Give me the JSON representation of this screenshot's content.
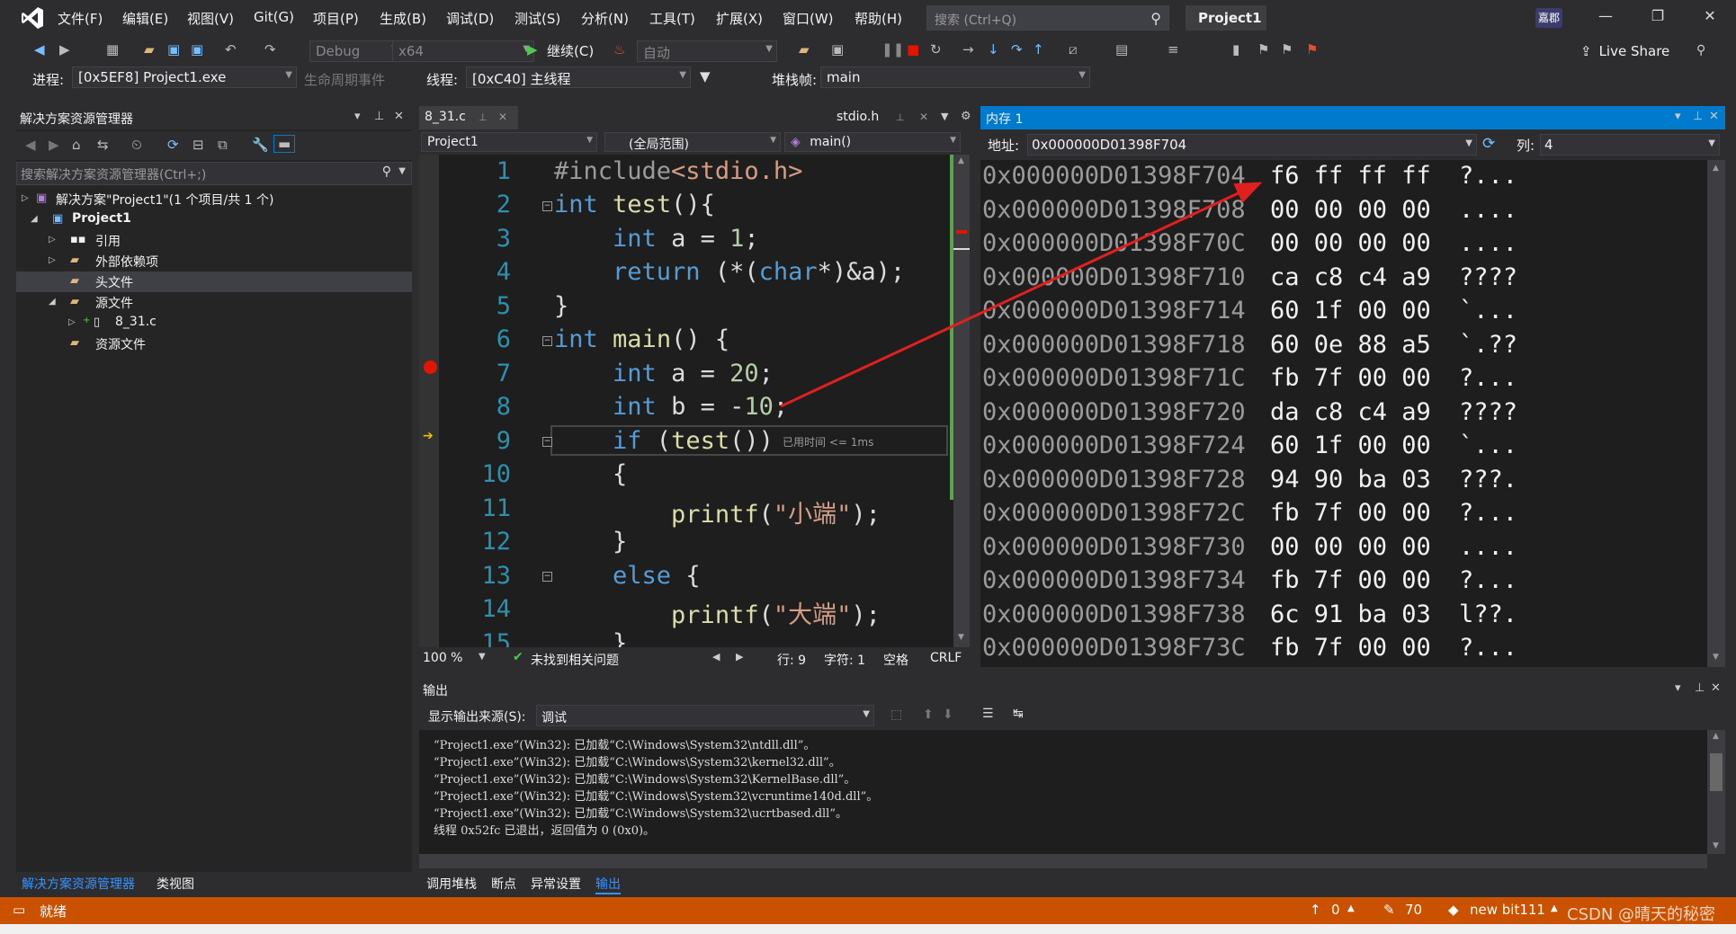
{
  "colors": {
    "accent": "#007acc",
    "status_bar": "#ca5100",
    "breakpoint": "#e51400",
    "arrow": "#e0201e"
  },
  "menu": [
    "文件(F)",
    "编辑(E)",
    "视图(V)",
    "Git(G)",
    "项目(P)",
    "生成(B)",
    "调试(D)",
    "测试(S)",
    "分析(N)",
    "工具(T)",
    "扩展(X)",
    "窗口(W)",
    "帮助(H)"
  ],
  "search": {
    "placeholder": "搜索 (Ctrl+Q)"
  },
  "project_name": "Project1",
  "avatar": "嘉郡",
  "toolbar": {
    "config": "Debug",
    "platform": "x64",
    "continue": "继续(C)",
    "auto": "自动",
    "live_share": "Live Share"
  },
  "debug_bar": {
    "process_label": "进程:",
    "process": "[0x5EF8] Project1.exe",
    "lifecycle": "生命周期事件",
    "thread_label": "线程:",
    "thread": "[0xC40] 主线程",
    "stack_label": "堆栈帧:",
    "stack": "main"
  },
  "solution_explorer": {
    "title": "解决方案资源管理器",
    "search_placeholder": "搜索解决方案资源管理器(Ctrl+;)",
    "tree": [
      {
        "label": "解决方案\"Project1\"(1 个项目/共 1 个)"
      },
      {
        "label": "Project1"
      },
      {
        "label": "引用"
      },
      {
        "label": "外部依赖项"
      },
      {
        "label": "头文件"
      },
      {
        "label": "源文件"
      },
      {
        "label": "8_31.c"
      },
      {
        "label": "资源文件"
      }
    ],
    "tabs": [
      "解决方案资源管理器",
      "类视图"
    ]
  },
  "editor": {
    "tab": "8_31.c",
    "tab2": "stdio.h",
    "nav_project": "Project1",
    "nav_scope": "(全局范围)",
    "nav_func": "main()",
    "elapsed": "已用时间 <= 1ms",
    "line_numbers": [
      "1",
      "2",
      "3",
      "4",
      "5",
      "6",
      "7",
      "8",
      "9",
      "10",
      "11",
      "12",
      "13",
      "14",
      "15"
    ],
    "status": {
      "zoom": "100 %",
      "issues": "未找到相关问题",
      "line": "行: 9",
      "char": "字符: 1",
      "space": "空格",
      "eol": "CRLF"
    }
  },
  "memory": {
    "title": "内存 1",
    "addr_label": "地址:",
    "addr": "0x000000D01398F704",
    "col_label": "列:",
    "col": "4",
    "rows": [
      {
        "addr": "0x000000D01398F704",
        "bytes": "f6 ff ff ff",
        "ascii": "?..."
      },
      {
        "addr": "0x000000D01398F708",
        "bytes": "00 00 00 00",
        "ascii": "...."
      },
      {
        "addr": "0x000000D01398F70C",
        "bytes": "00 00 00 00",
        "ascii": "...."
      },
      {
        "addr": "0x000000D01398F710",
        "bytes": "ca c8 c4 a9",
        "ascii": "????"
      },
      {
        "addr": "0x000000D01398F714",
        "bytes": "60 1f 00 00",
        "ascii": "`..."
      },
      {
        "addr": "0x000000D01398F718",
        "bytes": "60 0e 88 a5",
        "ascii": "`.??"
      },
      {
        "addr": "0x000000D01398F71C",
        "bytes": "fb 7f 00 00",
        "ascii": "?..."
      },
      {
        "addr": "0x000000D01398F720",
        "bytes": "da c8 c4 a9",
        "ascii": "????"
      },
      {
        "addr": "0x000000D01398F724",
        "bytes": "60 1f 00 00",
        "ascii": "`..."
      },
      {
        "addr": "0x000000D01398F728",
        "bytes": "94 90 ba 03",
        "ascii": "???."
      },
      {
        "addr": "0x000000D01398F72C",
        "bytes": "fb 7f 00 00",
        "ascii": "?..."
      },
      {
        "addr": "0x000000D01398F730",
        "bytes": "00 00 00 00",
        "ascii": "...."
      },
      {
        "addr": "0x000000D01398F734",
        "bytes": "fb 7f 00 00",
        "ascii": "?..."
      },
      {
        "addr": "0x000000D01398F738",
        "bytes": "6c 91 ba 03",
        "ascii": "l??."
      },
      {
        "addr": "0x000000D01398F73C",
        "bytes": "fb 7f 00 00",
        "ascii": "?..."
      }
    ]
  },
  "output": {
    "title": "输出",
    "source_label": "显示输出来源(S):",
    "source": "调试",
    "lines": [
      "“Project1.exe”(Win32): 已加载“C:\\Windows\\System32\\ntdll.dll”。",
      "“Project1.exe”(Win32): 已加载“C:\\Windows\\System32\\kernel32.dll”。",
      "“Project1.exe”(Win32): 已加载“C:\\Windows\\System32\\KernelBase.dll”。",
      "“Project1.exe”(Win32): 已加载“C:\\Windows\\System32\\vcruntime140d.dll”。",
      "“Project1.exe”(Win32): 已加载“C:\\Windows\\System32\\ucrtbased.dll”。",
      "线程 0x52fc 已退出，返回值为 0 (0x0)。"
    ],
    "tabs": [
      "调用堆栈",
      "断点",
      "异常设置",
      "输出"
    ]
  },
  "statusbar": {
    "ready": "就绪",
    "errors": "0",
    "edits": "70",
    "branch": "new bit111",
    "watermark": "CSDN @晴天的秘密"
  }
}
